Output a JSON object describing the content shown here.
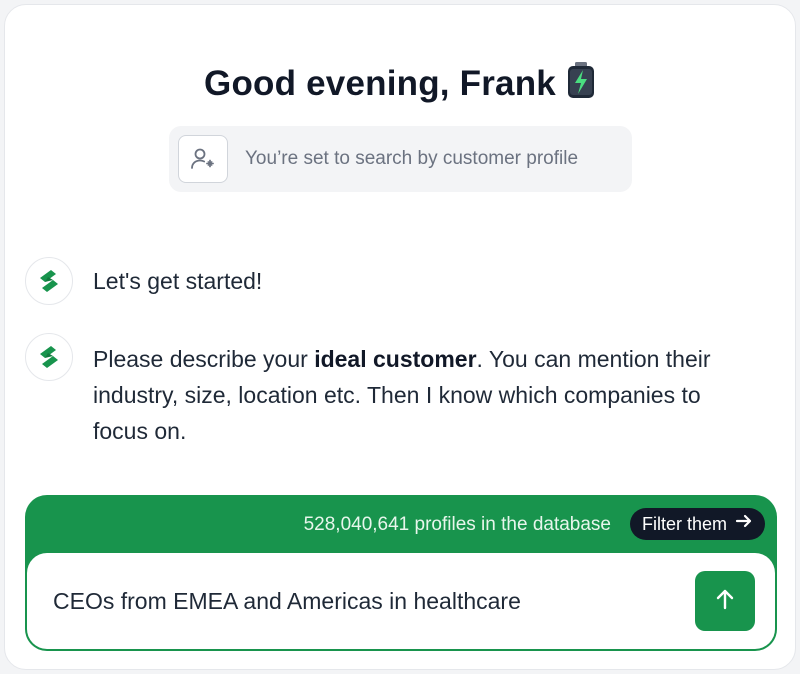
{
  "header": {
    "greeting": "Good evening, Frank",
    "greeting_icon": "battery-icon"
  },
  "mode": {
    "icon": "user-sparkle-icon",
    "text": "You’re set to search by customer profile"
  },
  "chat": {
    "messages": [
      {
        "avatar": "brand-logo-icon",
        "text": "Let's get started!"
      },
      {
        "avatar": "brand-logo-icon",
        "text_before": "Please describe your ",
        "text_bold": "ideal customer",
        "text_after": ". You can mention their industry, size, location etc. Then I know which companies to focus on."
      }
    ]
  },
  "composer": {
    "profile_count": "528,040,641 profiles in the database",
    "filter_label": "Filter them",
    "input_value": "CEOs from EMEA and Americas in healthcare",
    "send_icon": "arrow-up-icon"
  },
  "colors": {
    "accent": "#18944d",
    "dark": "#111827",
    "muted": "#6b7280"
  }
}
